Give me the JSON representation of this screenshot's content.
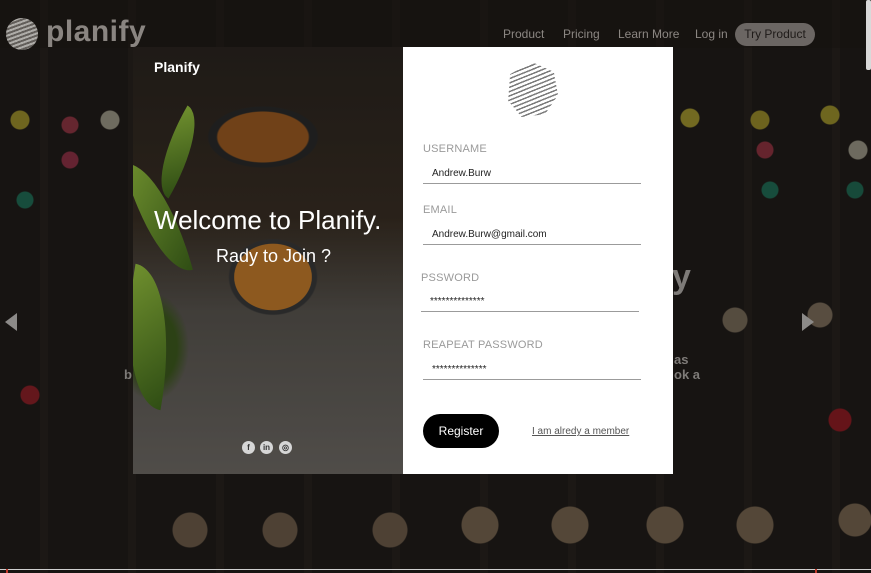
{
  "background": {
    "brand": "planify",
    "nav": [
      "Product",
      "Pricing",
      "Learn More",
      "Log in"
    ],
    "cta_label": "Try Product",
    "ghost_text": {
      "heading_tail": "y",
      "line1_left": "b",
      "line1_right": "as",
      "line2_right": "ok a"
    }
  },
  "modal": {
    "brand": "Planify",
    "welcome": "Welcome to Planify.",
    "subtitle": "Rady to Join ?",
    "social": [
      {
        "icon": "facebook-icon",
        "glyph": "f"
      },
      {
        "icon": "linkedin-icon",
        "glyph": "in"
      },
      {
        "icon": "instagram-icon",
        "glyph": "◎"
      }
    ],
    "form": {
      "username": {
        "label": "USERNAME",
        "value": "Andrew.Burw"
      },
      "email": {
        "label": "EMAIL",
        "value": "Andrew.Burw@gmail.com"
      },
      "password": {
        "label": "PSSWORD",
        "value": "**************"
      },
      "repeat_password": {
        "label": "REAPEAT PASSWORD",
        "value": "**************"
      },
      "register_label": "Register",
      "member_link": "I am alredy a member"
    }
  },
  "colors": {
    "accent": "#000000",
    "form_bg": "#ffffff",
    "label": "#9a9a9a"
  }
}
